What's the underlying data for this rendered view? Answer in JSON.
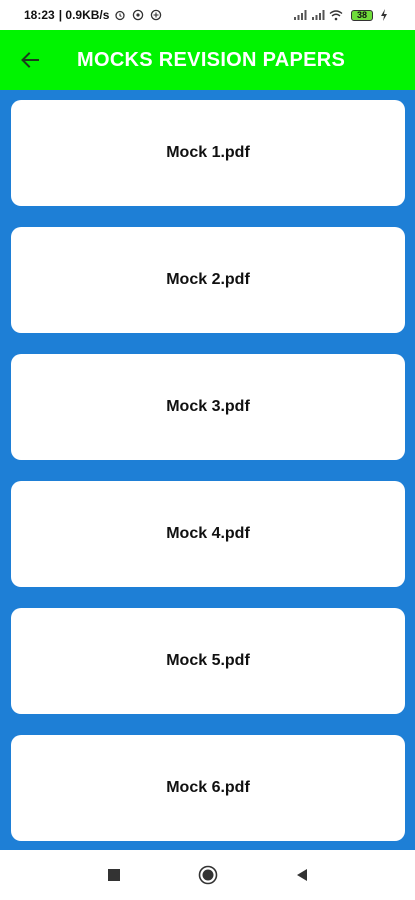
{
  "status_bar": {
    "time": "18:23",
    "network_speed": "| 0.9KB/s",
    "battery_level": "38",
    "left_icons": [
      "alarm-icon",
      "whatsapp-icon",
      "data-saver-icon"
    ],
    "right_icons": [
      "signal-icon",
      "signal-icon",
      "wifi-icon",
      "battery-icon",
      "charging-icon"
    ]
  },
  "app_bar": {
    "title": "MOCKS REVISION PAPERS",
    "back_icon": "arrow-left-icon",
    "color": "#00f400"
  },
  "files": [
    {
      "label": "Mock 1.pdf"
    },
    {
      "label": "Mock 2.pdf"
    },
    {
      "label": "Mock 3.pdf"
    },
    {
      "label": "Mock 4.pdf"
    },
    {
      "label": "Mock 5.pdf"
    },
    {
      "label": "Mock 6.pdf"
    }
  ],
  "nav_bar": {
    "buttons": [
      "recents-icon",
      "home-icon",
      "back-triangle-icon"
    ]
  },
  "colors": {
    "background": "#1e7fd6",
    "card": "#ffffff",
    "app_bar": "#00f400"
  }
}
